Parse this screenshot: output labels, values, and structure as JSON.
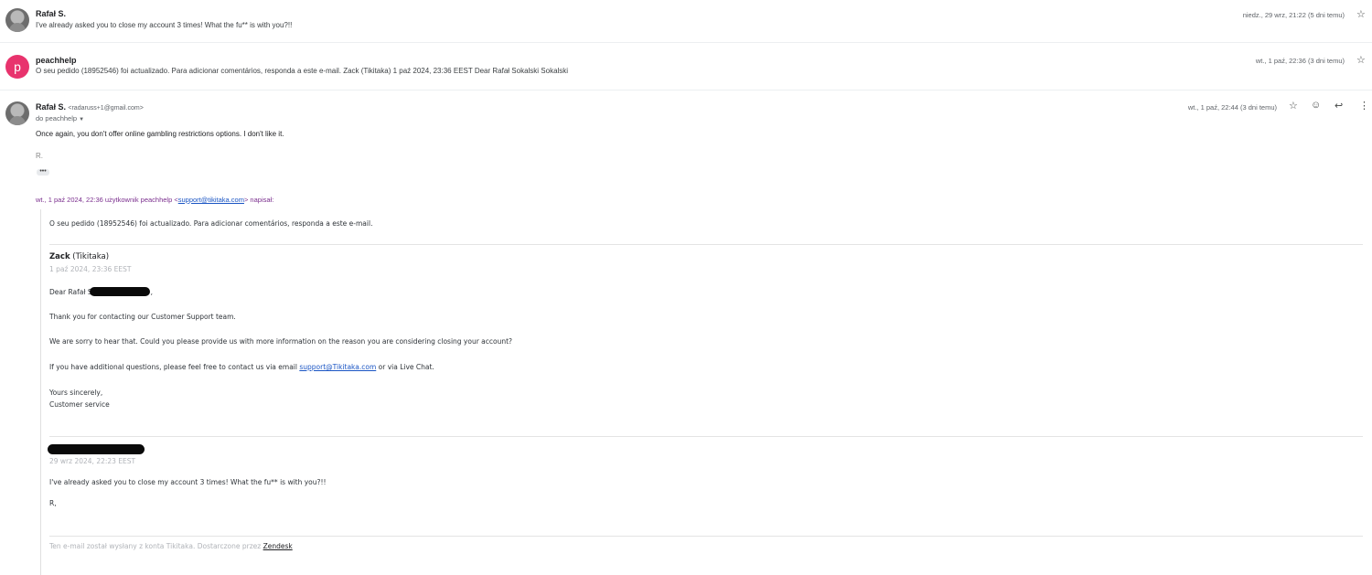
{
  "thread": [
    {
      "sender": "Rafał S.",
      "snippet": "I've already asked you to close my account 3 times! What the fu** is with you?!!",
      "date": "niedz., 29 wrz, 21:22 (5 dni temu)"
    },
    {
      "avatar_letter": "p",
      "sender": "peachhelp",
      "snippet": "O seu pedido (18952546) foi actualizado. Para adicionar comentários, responda a este e-mail. Zack (Tikitaka) 1 paź 2024, 23:36 EEST Dear Rafał Sokalski Sokalski",
      "date": "wt., 1 paź, 22:36 (3 dni temu)"
    }
  ],
  "open_message": {
    "sender": "Rafał S.",
    "email": "<radaruss+1@gmail.com>",
    "to": "do peachhelp",
    "date": "wt., 1 paź, 22:44 (3 dni temu)",
    "body": "Once again, you don't offer online gambling restrictions options. I don't like it.",
    "signature": "R.",
    "dots": "•••",
    "quote_header": {
      "prefix": "wt., 1 paź 2024, 22:36 użytkownik peachhelp <",
      "email": "support@tikitaka.com",
      "suffix": "> napisał:"
    },
    "quoted": {
      "intro": "O seu pedido (18952546) foi actualizado. Para adicionar comentários, responda a este e-mail.",
      "author_name": "Zack",
      "author_org": "(Tikitaka)",
      "author_date": "1 paź 2024, 23:36 EEST",
      "greeting": "Dear Rafał S",
      "greeting_end": ",",
      "p1": "Thank you for contacting our Customer Support team.",
      "p2": "We are sorry to hear that. Could you please provide us with more information on the reason you are considering closing your account?",
      "p3_prefix": "If you have additional questions, please feel free to contact us via email ",
      "p3_link": "support@Tikitaka.com",
      "p3_suffix": " or via Live Chat.",
      "closing1": "Yours sincerely,",
      "closing2": "Customer service",
      "prev_date": "29 wrz 2024, 22:23 EEST",
      "prev_body": "I've already asked you to close my account 3 times! What the fu** is with you?!!",
      "prev_sig": "R,",
      "footer_prefix": "Ten e-mail został wysłany z konta Tikitaka. Dostarczone przez ",
      "footer_link": "Zendesk"
    }
  },
  "icons": {
    "star": "star-icon",
    "emoji": "emoji-icon",
    "reply": "reply-icon",
    "more": "more-vert-icon"
  }
}
